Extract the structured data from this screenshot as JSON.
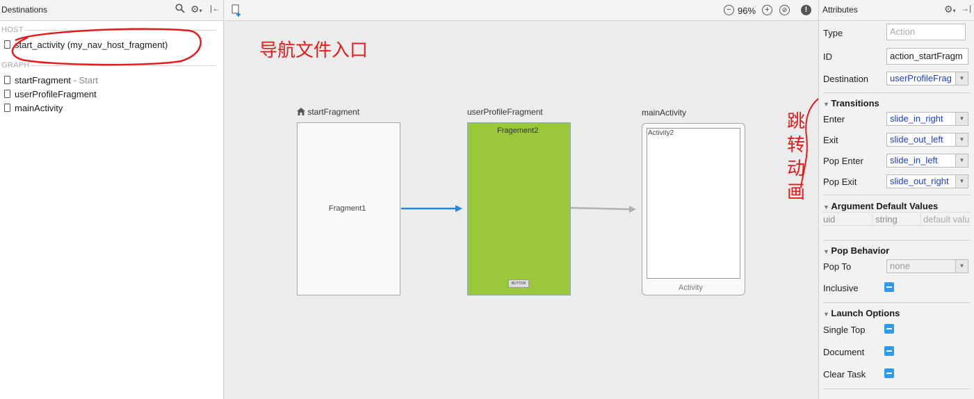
{
  "left_panel": {
    "title": "Destinations",
    "host_label": "HOST",
    "graph_label": "GRAPH",
    "host_item": "start_activity (my_nav_host_fragment)",
    "graph_items": [
      {
        "label": "startFragment",
        "suffix": " - Start"
      },
      {
        "label": "userProfileFragment",
        "suffix": ""
      },
      {
        "label": "mainActivity",
        "suffix": ""
      }
    ]
  },
  "canvas": {
    "zoom": "96%",
    "annotation_entry": "导航文件入口",
    "nodes": {
      "start_label": "startFragment",
      "start_text": "Fragment1",
      "profile_label": "userProfileFragment",
      "profile_text": "Fragement2",
      "profile_button": "BUTTON",
      "main_label": "mainActivity",
      "main_text": "Activity2",
      "main_footer": "Activity"
    },
    "colors": {
      "accent": "#1e88e5",
      "fragment2": "#9bc83a",
      "annotation": "#e31b1b"
    }
  },
  "attributes": {
    "title": "Attributes",
    "type_label": "Type",
    "type_placeholder": "Action",
    "id_label": "ID",
    "id_value": "action_startFragm",
    "destination_label": "Destination",
    "destination_value": "userProfileFrag",
    "transitions_head": "Transitions",
    "enter_label": "Enter",
    "enter_value": "slide_in_right",
    "exit_label": "Exit",
    "exit_value": "slide_out_left",
    "pop_enter_label": "Pop Enter",
    "pop_enter_value": "slide_in_left",
    "pop_exit_label": "Pop Exit",
    "pop_exit_value": "slide_out_right",
    "arg_head": "Argument Default Values",
    "arg_cols": [
      "uid",
      "string",
      "default valu"
    ],
    "pop_behavior_head": "Pop Behavior",
    "pop_to_label": "Pop To",
    "pop_to_value": "none",
    "inclusive_label": "Inclusive",
    "launch_head": "Launch Options",
    "single_top_label": "Single Top",
    "document_label": "Document",
    "clear_task_label": "Clear Task",
    "annotation_transition": [
      "跳",
      "转",
      "动",
      "画"
    ]
  }
}
